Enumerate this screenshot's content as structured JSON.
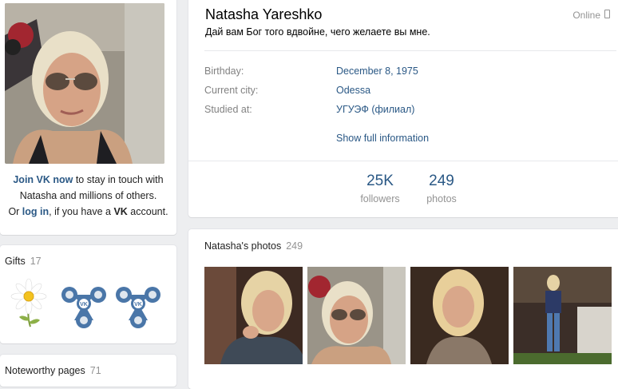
{
  "profile": {
    "name": "Natasha Yareshko",
    "online_status": "Online",
    "status_text": "Дай вам Бог того вдвойне, чего желаете вы мне.",
    "info_rows": [
      {
        "label": "Birthday:",
        "value": "December 8, 1975"
      },
      {
        "label": "Current city:",
        "value": "Odessa"
      },
      {
        "label": "Studied at:",
        "value": "УГУЭФ (филиал)"
      }
    ],
    "show_full_label": "Show full information",
    "counters": [
      {
        "value": "25K",
        "label": "followers"
      },
      {
        "value": "249",
        "label": "photos"
      }
    ]
  },
  "join_prompt": {
    "join_link": "Join VK now",
    "line1_rest": " to stay in touch with",
    "line2": "Natasha and millions of others.",
    "line3_pre": "Or ",
    "login_link": "log in",
    "line3_mid": ", if you have a ",
    "vk": "VK",
    "line3_post": " account."
  },
  "gifts": {
    "title": "Gifts",
    "count": "17",
    "items": [
      "daisy-gift",
      "vk-fidget-spinner-gift",
      "vk-fidget-spinner-gift"
    ]
  },
  "noteworthy": {
    "title": "Noteworthy pages",
    "count": "71"
  },
  "photos": {
    "title": "Natasha's photos",
    "count": "249"
  },
  "colors": {
    "link": "#2a5885",
    "muted": "#939393",
    "label": "#828282",
    "background": "#edeef0",
    "spinner": "#4a76a8"
  }
}
